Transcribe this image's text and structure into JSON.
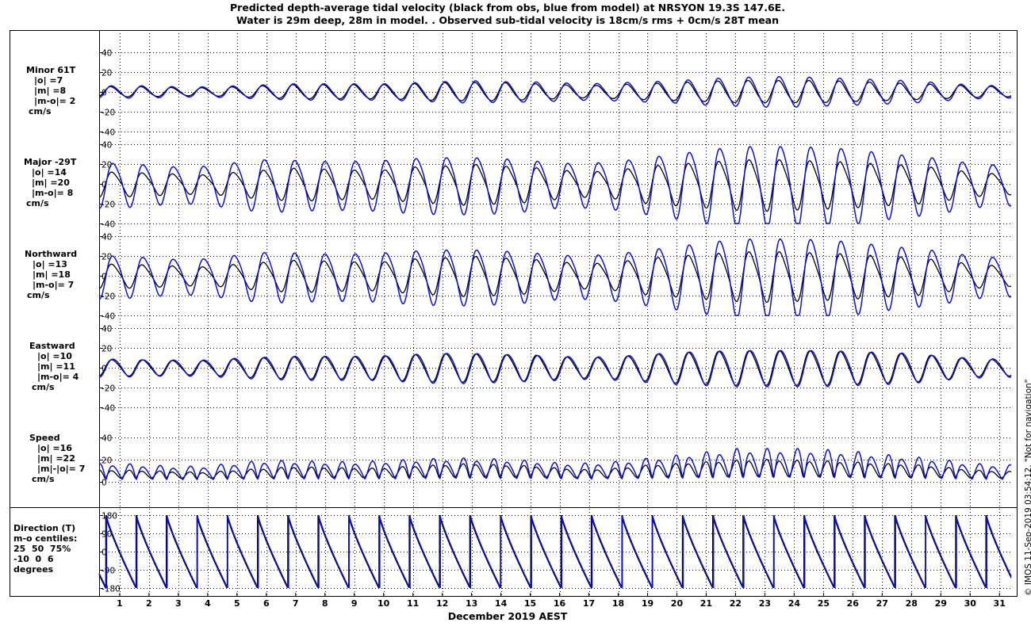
{
  "title_lines": [
    "Predicted depth-average tidal velocity (black from obs, blue from model) at NRSYON 19.3S 147.6E.",
    "Water is 29m deep, 28m in model. . Observed sub-tidal velocity is 18cm/s rms + 0cm/s 28T mean"
  ],
  "copyright": "© IMOS 11-Sep-2019 03:54:12.  \"Not for navigation\"",
  "colors": {
    "obs": "#000000",
    "model": "#1010c8",
    "grid": "#000000"
  },
  "panels": [
    {
      "id": "minor",
      "label_lines": [
        "Minor 61T",
        "|o| =7",
        "|m| =8",
        "|m-o|= 2",
        "cm/s"
      ],
      "yticks": [
        "40",
        "20",
        "0",
        "-20",
        "-40"
      ],
      "ylim": [
        -40,
        40
      ]
    },
    {
      "id": "major",
      "label_lines": [
        "Major -29T",
        "|o| =14",
        "|m| =20",
        "|m-o|= 8",
        "cm/s"
      ],
      "yticks": [
        "40",
        "20",
        "0",
        "-20",
        "-40"
      ],
      "ylim": [
        -40,
        40
      ]
    },
    {
      "id": "northward",
      "label_lines": [
        "Northward",
        "|o| =13",
        "|m| =18",
        "|m-o|= 7",
        "cm/s"
      ],
      "yticks": [
        "40",
        "20",
        "0",
        "-20",
        "-40"
      ],
      "ylim": [
        -40,
        40
      ]
    },
    {
      "id": "eastward",
      "label_lines": [
        "Eastward",
        "|o| =10",
        "|m| =11",
        "|m-o|= 4",
        "cm/s"
      ],
      "yticks": [
        "40",
        "20",
        "0",
        "-20",
        "-40"
      ],
      "ylim": [
        -40,
        40
      ]
    },
    {
      "id": "speed",
      "label_lines": [
        "Speed",
        "|o| =16",
        "|m| =22",
        "|m|-|o|= 7",
        "cm/s"
      ],
      "yticks": [
        "40",
        "20",
        "0"
      ],
      "ylim": [
        0,
        40
      ]
    },
    {
      "id": "direction",
      "label_lines": [
        "Direction (T)",
        "m-o centiles:",
        "25  50  75%",
        "-10  0  6",
        "degrees"
      ],
      "yticks": [
        "180",
        "90",
        "0",
        "-90",
        "-180"
      ],
      "ylim": [
        -180,
        180
      ]
    }
  ],
  "chart_data": {
    "type": "line",
    "xlabel": "December 2019 AEST",
    "xticks": [
      "1",
      "2",
      "3",
      "4",
      "5",
      "6",
      "7",
      "8",
      "9",
      "10",
      "11",
      "12",
      "13",
      "14",
      "15",
      "16",
      "17",
      "18",
      "19",
      "20",
      "21",
      "22",
      "23",
      "24",
      "25",
      "26",
      "27",
      "28",
      "29",
      "30",
      "31"
    ],
    "xlim_days": [
      0.3,
      31.4
    ],
    "series_names": [
      "obs",
      "model"
    ],
    "tidal_period_hours": 24.84,
    "amplitude_envelope_cm_s": {
      "major_obs": [
        12,
        11,
        10,
        9,
        12,
        14,
        16,
        15,
        14,
        14,
        17,
        18,
        20,
        18,
        17,
        14,
        12,
        14,
        18,
        20,
        22,
        24,
        25,
        24,
        23,
        22,
        20,
        19,
        16,
        12,
        10
      ],
      "major_model": [
        22,
        20,
        18,
        19,
        23,
        26,
        25,
        24,
        24,
        25,
        27,
        28,
        28,
        27,
        25,
        22,
        22,
        24,
        28,
        32,
        36,
        40,
        40,
        40,
        39,
        37,
        33,
        30,
        27,
        22,
        20
      ],
      "minor_obs": [
        5,
        5,
        4,
        4,
        5,
        6,
        7,
        7,
        7,
        7,
        8,
        9,
        9,
        9,
        8,
        7,
        6,
        7,
        8,
        9,
        10,
        11,
        11,
        11,
        11,
        10,
        9,
        8,
        7,
        6,
        5
      ],
      "minor_model": [
        6,
        6,
        5,
        5,
        6,
        7,
        8,
        8,
        8,
        8,
        9,
        10,
        11,
        10,
        10,
        9,
        8,
        9,
        10,
        11,
        13,
        14,
        15,
        15,
        14,
        13,
        12,
        11,
        9,
        7,
        6
      ],
      "east_obs": [
        8,
        8,
        7,
        7,
        9,
        10,
        11,
        11,
        11,
        12,
        13,
        14,
        14,
        13,
        13,
        11,
        10,
        11,
        13,
        15,
        16,
        17,
        17,
        17,
        17,
        16,
        15,
        14,
        12,
        9,
        8
      ],
      "east_model": [
        9,
        8,
        8,
        8,
        10,
        11,
        12,
        12,
        12,
        12,
        14,
        15,
        15,
        14,
        13,
        12,
        11,
        12,
        14,
        16,
        17,
        18,
        18,
        18,
        18,
        17,
        16,
        15,
        12,
        10,
        9
      ]
    }
  }
}
